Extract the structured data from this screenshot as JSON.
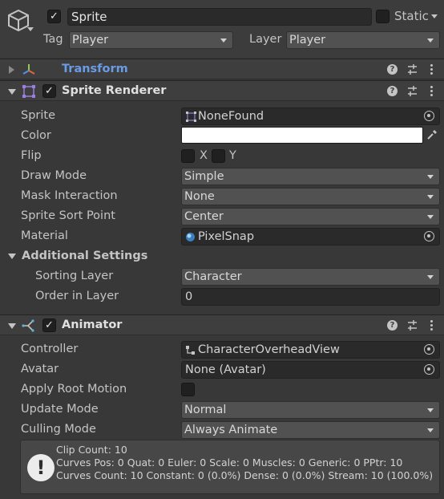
{
  "header": {
    "active_check": "✓",
    "object_name": "Sprite",
    "static_label": "Static",
    "tag_label": "Tag",
    "tag_value": "Player",
    "layer_label": "Layer",
    "layer_value": "Player"
  },
  "transform": {
    "title": "Transform",
    "title_color": "#6a9ce6"
  },
  "sprite_renderer": {
    "title": "Sprite Renderer",
    "enabled_check": "✓",
    "rows": {
      "sprite": {
        "label": "Sprite",
        "value": "NoneFound"
      },
      "color": {
        "label": "Color",
        "value": "#ffffff"
      },
      "flip": {
        "label": "Flip",
        "x": "X",
        "y": "Y"
      },
      "draw_mode": {
        "label": "Draw Mode",
        "value": "Simple"
      },
      "mask_interaction": {
        "label": "Mask Interaction",
        "value": "None"
      },
      "sort_point": {
        "label": "Sprite Sort Point",
        "value": "Center"
      },
      "material": {
        "label": "Material",
        "value": "PixelSnap"
      }
    },
    "additional": {
      "title": "Additional Settings",
      "sorting_layer": {
        "label": "Sorting Layer",
        "value": "Character"
      },
      "order_in_layer": {
        "label": "Order in Layer",
        "value": "0"
      }
    }
  },
  "animator": {
    "title": "Animator",
    "enabled_check": "✓",
    "rows": {
      "controller": {
        "label": "Controller",
        "value": "CharacterOverheadView"
      },
      "avatar": {
        "label": "Avatar",
        "value": "None (Avatar)"
      },
      "apply_root_motion": {
        "label": "Apply Root Motion"
      },
      "update_mode": {
        "label": "Update Mode",
        "value": "Normal"
      },
      "culling_mode": {
        "label": "Culling Mode",
        "value": "Always Animate"
      }
    },
    "info": {
      "icon_glyph": "!",
      "line1": "Clip Count: 10",
      "line2": "Curves Pos: 0 Quat: 0 Euler: 0 Scale: 0 Muscles: 0 Generic: 0 PPtr: 10",
      "line3": "Curves Count: 10 Constant: 0 (0.0%) Dense: 0 (0.0%) Stream: 10 (100.0%)"
    }
  }
}
